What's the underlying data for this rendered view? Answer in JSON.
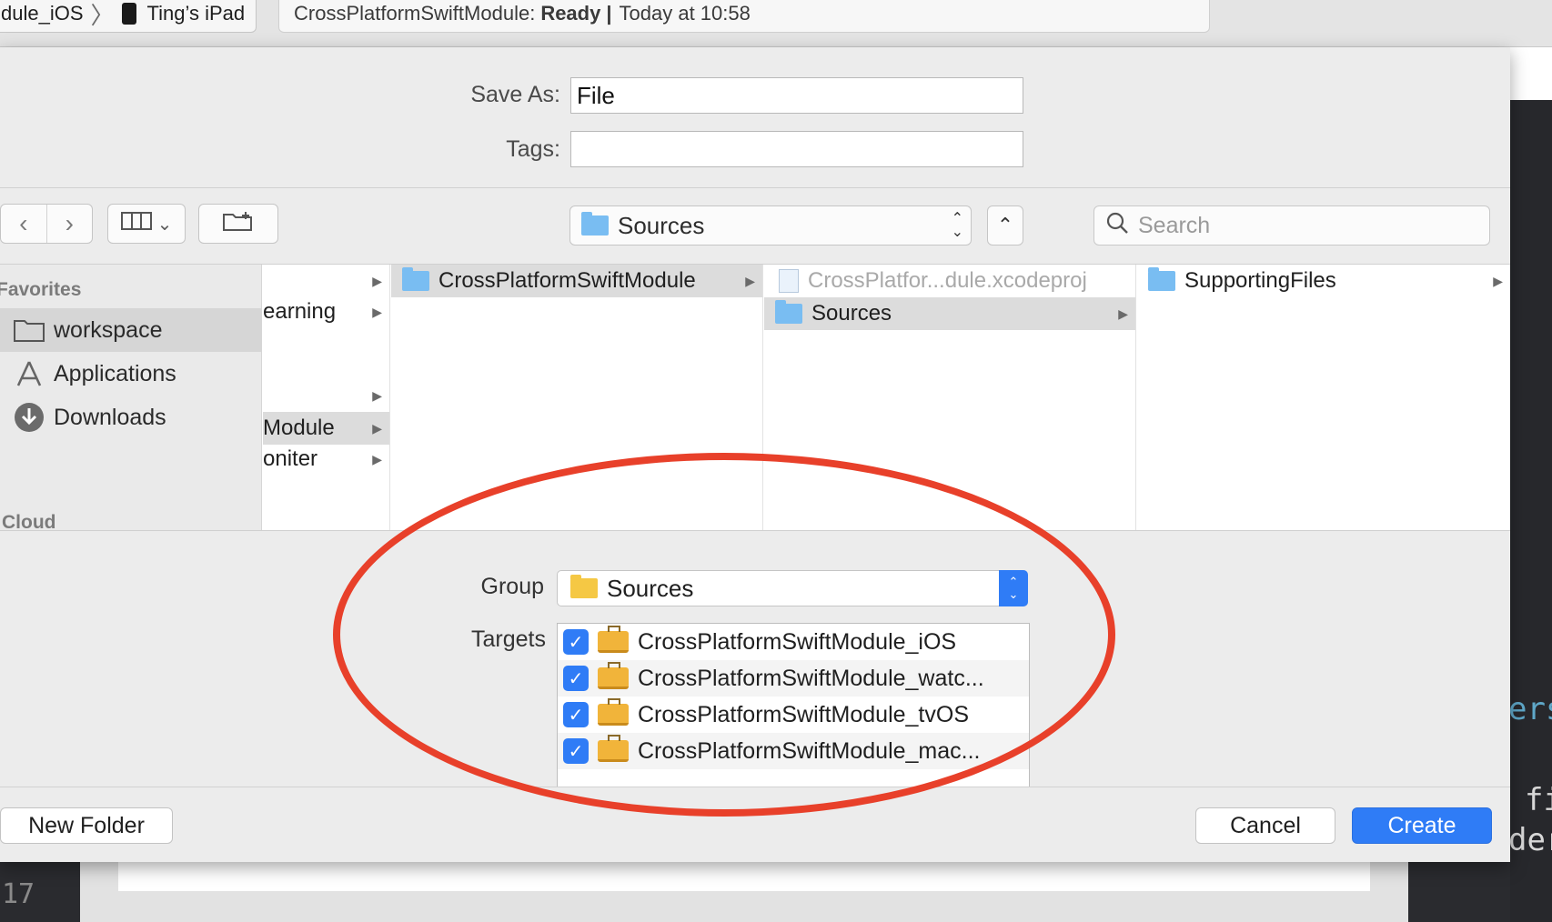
{
  "xcode": {
    "scheme_name": "dule_iOS",
    "device_name": "Ting’s iPad",
    "activity_project": "CrossPlatformSwiftModule:",
    "activity_status": "Ready",
    "activity_sep": "|",
    "activity_time": "Today at 10:58",
    "line_number": "17",
    "code_fragments": [
      "ers",
      "fi",
      "der"
    ]
  },
  "save_panel": {
    "save_as_label": "Save As:",
    "save_as_value": "File",
    "tags_label": "Tags:",
    "tags_value": "",
    "location": "Sources",
    "search_placeholder": "Search",
    "sidebar": {
      "heading": "Favorites",
      "items": [
        {
          "label": "workspace",
          "icon": "folder-icon"
        },
        {
          "label": "Applications",
          "icon": "applications-icon"
        },
        {
          "label": "Downloads",
          "icon": "downloads-icon"
        }
      ],
      "truncated_heading": "Cloud"
    },
    "columns": {
      "col1": [
        "earning",
        "Module",
        "oniter"
      ],
      "col2": [
        "CrossPlatformSwiftModule"
      ],
      "col3": [
        "CrossPlatfor...dule.xcodeproj",
        "Sources"
      ],
      "col4": [
        "SupportingFiles"
      ]
    },
    "group_label": "Group",
    "group_value": "Sources",
    "targets_label": "Targets",
    "targets": [
      {
        "name": "CrossPlatformSwiftModule_iOS",
        "checked": true
      },
      {
        "name": "CrossPlatformSwiftModule_watc...",
        "checked": true
      },
      {
        "name": "CrossPlatformSwiftModule_tvOS",
        "checked": true
      },
      {
        "name": "CrossPlatformSwiftModule_mac...",
        "checked": true
      }
    ],
    "new_folder_label": "New Folder",
    "cancel_label": "Cancel",
    "create_label": "Create"
  },
  "colors": {
    "accent": "#2f7cf6",
    "annotation": "#e8402a",
    "folder_blue": "#79bdf2",
    "folder_yellow": "#f5c844"
  }
}
